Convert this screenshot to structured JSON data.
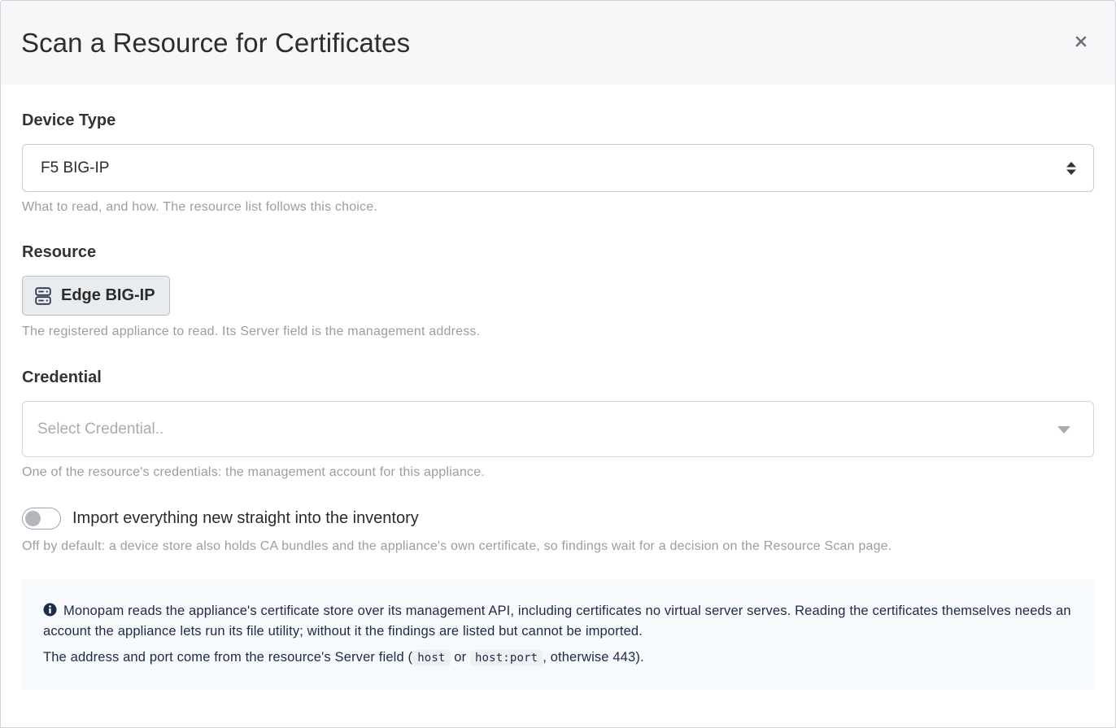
{
  "header": {
    "title": "Scan a Resource for Certificates",
    "close_label": "×"
  },
  "device_type": {
    "label": "Device Type",
    "value": "F5 BIG-IP",
    "help": "What to read, and how. The resource list follows this choice."
  },
  "resource": {
    "label": "Resource",
    "chip_label": "Edge BIG-IP",
    "chip_icon": "server-icon",
    "help": "The registered appliance to read. Its Server field is the management address."
  },
  "credential": {
    "label": "Credential",
    "placeholder": "Select Credential..",
    "help": "One of the resource's credentials: the management account for this appliance."
  },
  "import_toggle": {
    "label": "Import everything new straight into the inventory",
    "enabled": false,
    "help": "Off by default: a device store also holds CA bundles and the appliance's own certificate, so findings wait for a decision on the Resource Scan page."
  },
  "info": {
    "paragraph1": "Monopam reads the appliance's certificate store over its management API, including certificates no virtual server serves. Reading the certificates themselves needs an account the appliance lets run its file utility; without it the findings are listed but cannot be imported.",
    "paragraph2_prefix": "The address and port come from the resource's Server field (",
    "code1": "host",
    "or_word": "or",
    "code2": "host:port",
    "paragraph2_suffix": ", otherwise 443)."
  },
  "colors": {
    "header_bg": "#f5f7f9",
    "info_bg": "#f6fafc",
    "info_text": "#1c2b46",
    "help_text": "#9a9ea3"
  }
}
